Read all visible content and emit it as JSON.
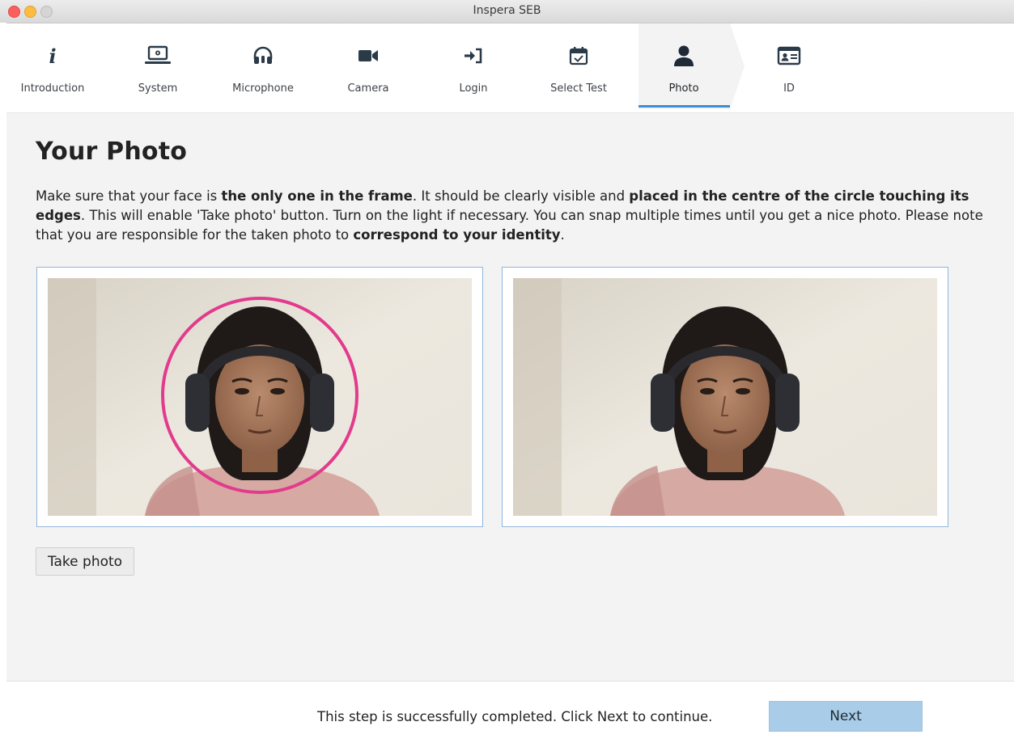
{
  "window": {
    "title": "Inspera SEB"
  },
  "steps": [
    {
      "label": "Introduction",
      "icon": "info-icon"
    },
    {
      "label": "System",
      "icon": "laptop-gear-icon"
    },
    {
      "label": "Microphone",
      "icon": "headset-icon"
    },
    {
      "label": "Camera",
      "icon": "video-camera-icon"
    },
    {
      "label": "Login",
      "icon": "sign-in-icon"
    },
    {
      "label": "Select Test",
      "icon": "calendar-check-icon"
    },
    {
      "label": "Photo",
      "icon": "user-icon",
      "active": true
    },
    {
      "label": "ID",
      "icon": "id-card-icon"
    }
  ],
  "main": {
    "title": "Your Photo",
    "instructions": {
      "p1": "Make sure that your face is ",
      "b1": "the only one in the frame",
      "p2": ". It should be clearly visible and ",
      "b2": "placed in the centre of the circle touching its edges",
      "p3": ". This will enable 'Take photo' button. Turn on the light if necessary. You can snap multiple times until you get a nice photo. Please note that you are responsible for the taken photo to ",
      "b3": "correspond to your identity",
      "p4": "."
    },
    "take_photo_label": "Take photo"
  },
  "footer": {
    "status": "This step is successfully completed. Click Next to continue.",
    "next_label": "Next"
  },
  "colors": {
    "accent": "#3a8fd6",
    "face_circle": "#e23a8c",
    "next_button": "#a9cde8"
  }
}
